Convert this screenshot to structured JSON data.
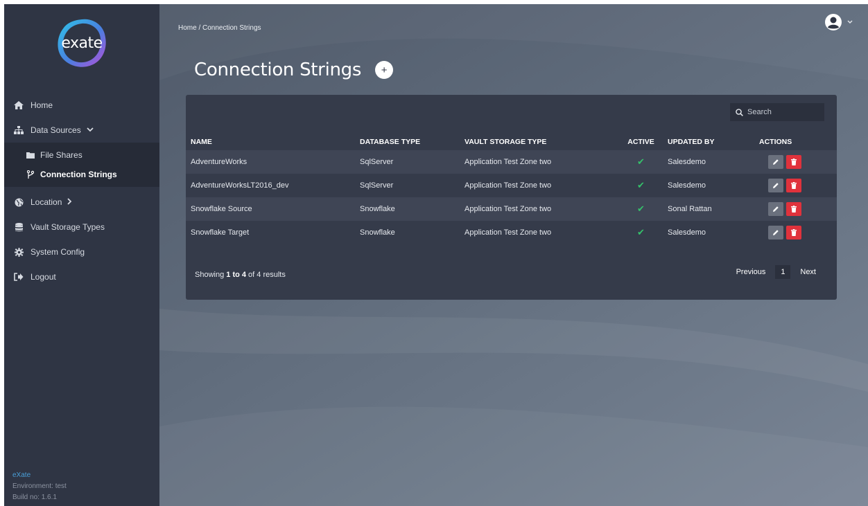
{
  "app": {
    "logo_text": "exate",
    "footer": {
      "brand": "eXate",
      "environment": "Environment: test",
      "build": "Build no: 1.6.1"
    }
  },
  "sidebar": {
    "items": [
      {
        "label": "Home",
        "icon": "home-icon"
      },
      {
        "label": "Data Sources",
        "icon": "sitemap-icon",
        "expanded": true,
        "children": [
          {
            "label": "File Shares",
            "icon": "folder-icon"
          },
          {
            "label": "Connection Strings",
            "icon": "branch-icon",
            "active": true
          }
        ]
      },
      {
        "label": "Location",
        "icon": "globe-icon"
      },
      {
        "label": "Vault Storage Types",
        "icon": "database-icon"
      },
      {
        "label": "System Config",
        "icon": "gear-icon"
      },
      {
        "label": "Logout",
        "icon": "sign-out-icon"
      }
    ]
  },
  "header": {
    "breadcrumb": "Home /  Connection Strings",
    "title": "Connection Strings",
    "add_label": "+"
  },
  "search": {
    "placeholder": "Search"
  },
  "table": {
    "columns": [
      "NAME",
      "DATABASE TYPE",
      "VAULT STORAGE TYPE",
      "ACTIVE",
      "UPDATED BY",
      "ACTIONS"
    ],
    "rows": [
      {
        "name": "AdventureWorks",
        "db_type": "SqlServer",
        "vault": "Application Test Zone two",
        "active": "✔",
        "updated_by": "Salesdemo"
      },
      {
        "name": "AdventureWorksLT2016_dev",
        "db_type": "SqlServer",
        "vault": "Application Test Zone two",
        "active": "✔",
        "updated_by": "Salesdemo"
      },
      {
        "name": "Snowflake Source",
        "db_type": "Snowflake",
        "vault": "Application Test Zone two",
        "active": "✔",
        "updated_by": "Sonal Rattan"
      },
      {
        "name": "Snowflake Target",
        "db_type": "Snowflake",
        "vault": "Application Test Zone two",
        "active": "✔",
        "updated_by": "Salesdemo"
      }
    ]
  },
  "summary": {
    "prefix": "Showing ",
    "range": "1 to 4",
    "suffix": " of 4 results"
  },
  "pagination": {
    "previous": "Previous",
    "current": "1",
    "next": "Next"
  },
  "colors": {
    "sidebar_bg": "#2f3544",
    "panel_bg": "#353b4a",
    "check_green": "#35c26b",
    "delete_red": "#e0323c",
    "brand_blue": "#4a9fd8"
  }
}
